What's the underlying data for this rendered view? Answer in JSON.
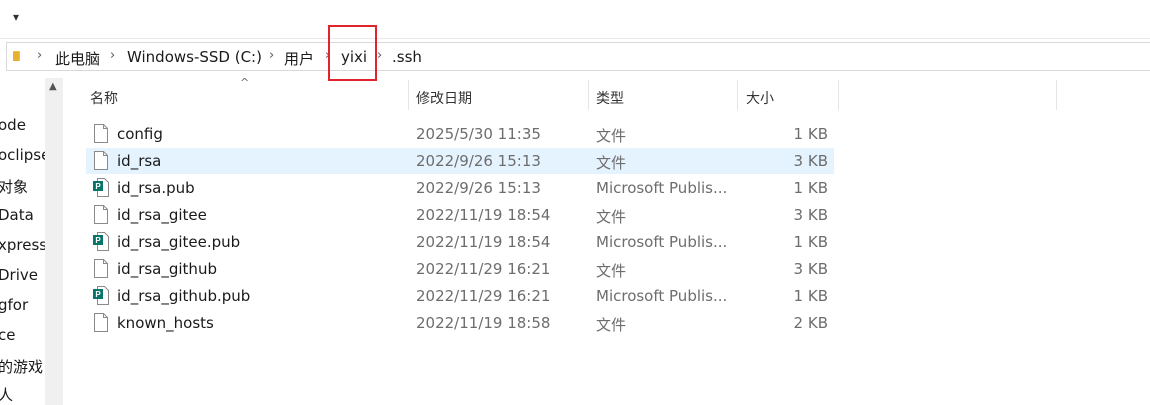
{
  "toolbar": {
    "dropdown_glyph": "▾"
  },
  "address_bar": {
    "crumbs": [
      "此电脑",
      "Windows-SSD (C:)",
      "用户",
      "yixi",
      ".ssh"
    ],
    "separator": "›",
    "highlight_color": "#e0242d"
  },
  "nav_pane": {
    "items": [
      "ode",
      "oclipse",
      "对象",
      "Data",
      "xpress",
      "Drive",
      "gfor",
      "ce",
      "的游戏",
      "人"
    ]
  },
  "columns": {
    "name": "名称",
    "date": "修改日期",
    "type": "类型",
    "size": "大小"
  },
  "files": [
    {
      "name": "config",
      "date": "2025/5/30 11:35",
      "type": "文件",
      "size": "1 KB",
      "icon": "file-icon",
      "selected": false
    },
    {
      "name": "id_rsa",
      "date": "2022/9/26 15:13",
      "type": "文件",
      "size": "3 KB",
      "icon": "file-icon",
      "selected": true
    },
    {
      "name": "id_rsa.pub",
      "date": "2022/9/26 15:13",
      "type": "Microsoft Publis...",
      "size": "1 KB",
      "icon": "publisher-icon",
      "selected": false
    },
    {
      "name": "id_rsa_gitee",
      "date": "2022/11/19 18:54",
      "type": "文件",
      "size": "3 KB",
      "icon": "file-icon",
      "selected": false
    },
    {
      "name": "id_rsa_gitee.pub",
      "date": "2022/11/19 18:54",
      "type": "Microsoft Publis...",
      "size": "1 KB",
      "icon": "publisher-icon",
      "selected": false
    },
    {
      "name": "id_rsa_github",
      "date": "2022/11/29 16:21",
      "type": "文件",
      "size": "3 KB",
      "icon": "file-icon",
      "selected": false
    },
    {
      "name": "id_rsa_github.pub",
      "date": "2022/11/29 16:21",
      "type": "Microsoft Publis...",
      "size": "1 KB",
      "icon": "publisher-icon",
      "selected": false
    },
    {
      "name": "known_hosts",
      "date": "2022/11/19 18:58",
      "type": "文件",
      "size": "2 KB",
      "icon": "file-icon",
      "selected": false
    }
  ],
  "colors": {
    "selection": "#e5f3ff",
    "publisher_teal": "#077568",
    "folder_yellow": "#f3c443"
  }
}
